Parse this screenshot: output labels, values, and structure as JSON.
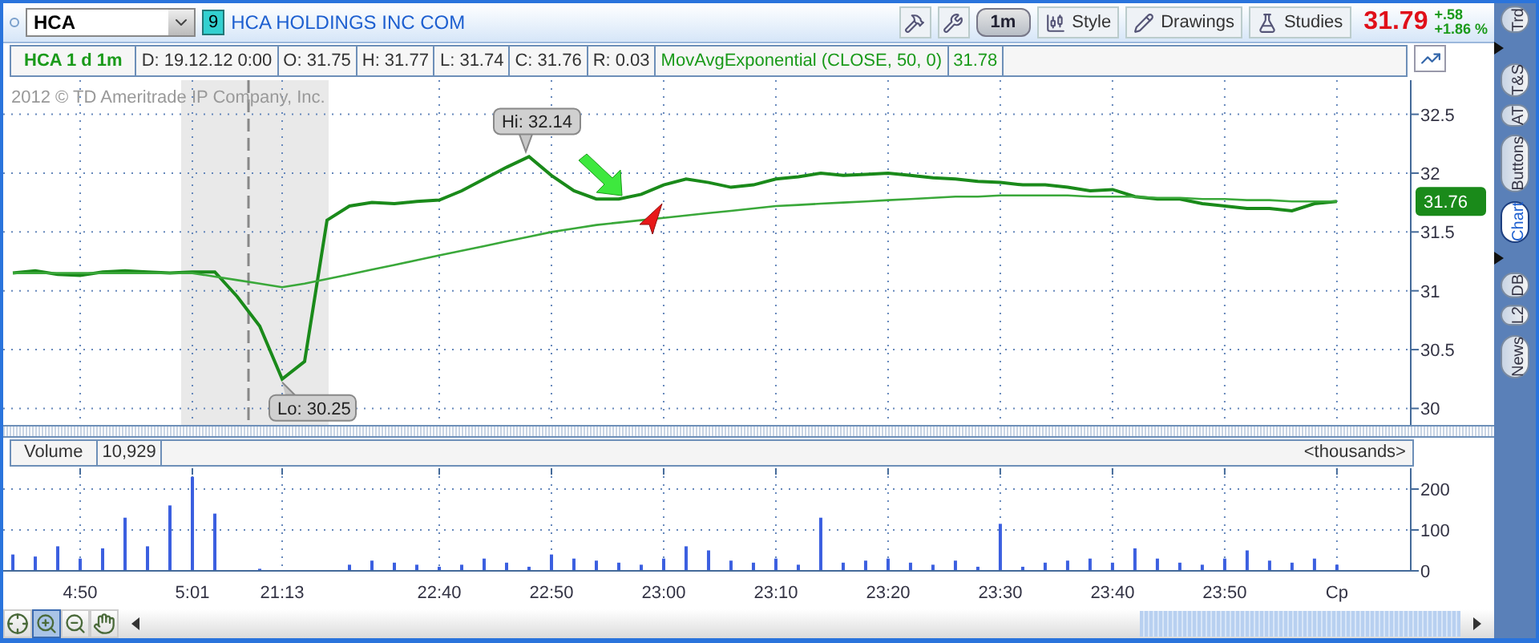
{
  "header": {
    "symbol": "HCA",
    "badge": "9",
    "company": "HCA HOLDINGS INC COM",
    "aggregation": "1m",
    "buttons": [
      {
        "kind": "style",
        "label": "Style"
      },
      {
        "kind": "drawings",
        "label": "Drawings"
      },
      {
        "kind": "studies",
        "label": "Studies"
      }
    ],
    "last_price": "31.79",
    "change": "+.58",
    "change_pct": "+1.86 %"
  },
  "info_bar": {
    "title": "HCA 1 d 1m",
    "fields": [
      "D: 19.12.12 0:00",
      "O: 31.75",
      "H: 31.77",
      "L: 31.74",
      "C: 31.76",
      "R: 0.03"
    ],
    "study_params": "(CLOSE, 50, 0)",
    "study_value": "31.78"
  },
  "price_chart": {
    "copyright": "2012 © TD Ameritrade IP Company, Inc.",
    "price_badge": "31.76",
    "chart_data": {
      "type": "line",
      "grid": true,
      "ylim": [
        29.86,
        32.79
      ],
      "yticks": [
        30,
        30.5,
        31,
        31.5,
        32,
        32.5
      ],
      "series": [
        {
          "color": "#1a8a1a",
          "values": [
            31.15,
            31.17,
            31.14,
            31.13,
            31.16,
            31.17,
            31.16,
            31.15,
            31.16,
            31.16,
            30.95,
            30.7,
            30.25,
            30.4,
            31.6,
            31.72,
            31.75,
            31.74,
            31.76,
            31.77,
            31.85,
            31.95,
            32.05,
            32.14,
            31.98,
            31.85,
            31.78,
            31.78,
            31.82,
            31.9,
            31.95,
            31.92,
            31.88,
            31.9,
            31.95,
            31.97,
            32,
            31.98,
            31.99,
            32,
            31.98,
            31.96,
            31.95,
            31.93,
            31.92,
            31.9,
            31.9,
            31.88,
            31.85,
            31.86,
            31.8,
            31.78,
            31.78,
            31.74,
            31.72,
            31.7,
            31.7,
            31.68,
            31.74,
            31.76
          ]
        },
        {
          "name": "MovAvgExponential",
          "color": "#3aa83a",
          "values": [
            31.15,
            31.15,
            31.15,
            31.15,
            31.15,
            31.15,
            31.15,
            31.15,
            31.15,
            31.12,
            31.09,
            31.06,
            31.03,
            31.06,
            31.1,
            31.14,
            31.18,
            31.22,
            31.26,
            31.3,
            31.34,
            31.38,
            31.42,
            31.46,
            31.5,
            31.53,
            31.56,
            31.58,
            31.6,
            31.62,
            31.64,
            31.66,
            31.68,
            31.7,
            31.72,
            31.73,
            31.74,
            31.75,
            31.76,
            31.77,
            31.78,
            31.79,
            31.8,
            31.8,
            31.81,
            31.81,
            31.81,
            31.81,
            31.8,
            31.8,
            31.8,
            31.79,
            31.79,
            31.78,
            31.78,
            31.77,
            31.77,
            31.76,
            31.76,
            31.76
          ]
        }
      ],
      "annotations": [
        {
          "text": "Hi: 32.14"
        },
        {
          "text": "Lo: 30.25"
        }
      ]
    }
  },
  "volume": {
    "value": "10,929",
    "units": "<thousands>",
    "chart_data": {
      "type": "bar",
      "grid": true,
      "ylim": [
        0,
        251
      ],
      "yticks": [
        0,
        100,
        200
      ],
      "categories": [
        null,
        null,
        null,
        "4:50",
        null,
        null,
        null,
        null,
        "5:01",
        null,
        null,
        null,
        "21:13",
        null,
        null,
        null,
        null,
        null,
        null,
        "22:40",
        null,
        null,
        null,
        null,
        "22:50",
        null,
        null,
        null,
        null,
        "23:00",
        null,
        null,
        null,
        null,
        "23:10",
        null,
        null,
        null,
        null,
        "23:20",
        null,
        null,
        null,
        null,
        "23:30",
        null,
        null,
        null,
        null,
        "23:40",
        null,
        null,
        null,
        null,
        "23:50",
        null,
        null,
        null,
        null,
        "Cp"
      ],
      "series": [
        {
          "name": "Volume",
          "color": "#3b5fe0",
          "values": [
            40,
            35,
            60,
            30,
            55,
            130,
            60,
            160,
            230,
            140,
            0,
            5,
            0,
            0,
            0,
            15,
            25,
            20,
            15,
            10,
            15,
            30,
            20,
            10,
            40,
            30,
            25,
            20,
            15,
            30,
            60,
            50,
            25,
            20,
            30,
            15,
            130,
            20,
            25,
            30,
            20,
            15,
            25,
            10,
            115,
            10,
            20,
            25,
            30,
            20,
            55,
            30,
            20,
            15,
            30,
            50,
            25,
            20,
            30,
            15
          ]
        }
      ]
    }
  },
  "tools": [
    {
      "kind": "crosshair",
      "selected": false
    },
    {
      "kind": "zoom-in",
      "selected": true
    },
    {
      "kind": "zoom-out",
      "selected": false
    },
    {
      "kind": "pan",
      "selected": false
    }
  ],
  "side_tabs": [
    {
      "label": "Trd",
      "selected": false
    },
    {
      "label": "T&S",
      "selected": false
    },
    {
      "label": "AT",
      "selected": false
    },
    {
      "label": "Buttons",
      "selected": false
    },
    {
      "label": "Chart",
      "selected": true
    },
    {
      "label": "DB",
      "selected": false
    },
    {
      "label": "L2",
      "selected": false
    },
    {
      "label": "News",
      "selected": false
    }
  ]
}
